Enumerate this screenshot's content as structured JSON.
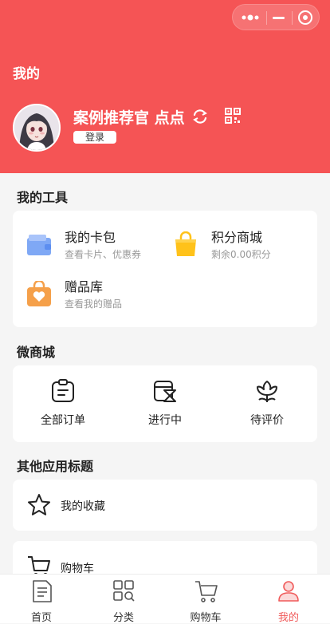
{
  "header": {
    "title": "我的",
    "bg_color": "#f55455",
    "capsule": {
      "menu_icon": "more-dots-icon",
      "minimize_icon": "minimize-icon",
      "close_icon": "target-icon"
    }
  },
  "profile": {
    "username": "案例推荐官 点点",
    "login_label": "登录",
    "switch_icon": "switch-account-icon",
    "qr_icon": "qr-code-icon"
  },
  "tools": {
    "title": "我的工具",
    "items": [
      {
        "name": "我的卡包",
        "desc": "查看卡片、优惠券",
        "icon": "wallet-icon"
      },
      {
        "name": "积分商城",
        "desc": "剩余0.00积分",
        "icon": "shopping-bag-icon"
      },
      {
        "name": "赠品库",
        "desc": "查看我的赠品",
        "icon": "gift-bag-icon"
      }
    ]
  },
  "shop": {
    "title": "微商城",
    "items": [
      {
        "label": "全部订单",
        "icon": "clipboard-icon"
      },
      {
        "label": "进行中",
        "icon": "hourglass-icon"
      },
      {
        "label": "待评价",
        "icon": "flower-icon"
      }
    ]
  },
  "other": {
    "title": "其他应用标题",
    "items": [
      {
        "label": "我的收藏",
        "icon": "star-icon"
      },
      {
        "label": "购物车",
        "icon": "cart-icon"
      }
    ]
  },
  "tabbar": {
    "active_color": "#f05a5a",
    "items": [
      {
        "label": "首页",
        "icon": "document-icon"
      },
      {
        "label": "分类",
        "icon": "category-grid-icon"
      },
      {
        "label": "购物车",
        "icon": "cart-icon"
      },
      {
        "label": "我的",
        "icon": "user-icon"
      }
    ]
  }
}
